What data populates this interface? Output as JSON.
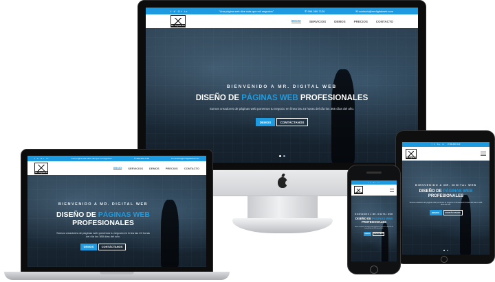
{
  "site": {
    "tagline": "\"Una página web dice más que mil negocios\"",
    "phone": "✆ 996-360-7120",
    "email": "✉ contacto@mrdigitalweb.com",
    "social": "f ✔ G+ in",
    "logo_text": "Mr. Digital Web",
    "nav": [
      {
        "label": "INICIO",
        "active": true
      },
      {
        "label": "SERVICIOS",
        "active": false
      },
      {
        "label": "DEMOS",
        "active": false
      },
      {
        "label": "PRECIOS",
        "active": false
      },
      {
        "label": "CONTACTO",
        "active": false
      }
    ],
    "hero": {
      "kicker": "BIENVENIDO A MR. DIGITAL WEB",
      "title_part1": "DISEÑO DE ",
      "title_highlight": "PÁGINAS WEB",
      "title_part2": " PROFESIONALES",
      "subtext": "Somos creadores de páginas web ponemos tu negocio en línea las 24 horas del día los 365 días del año.",
      "button_primary": "DEMOS",
      "button_secondary": "CONTÁCTANOS"
    }
  },
  "colors": {
    "accent": "#1e9be0",
    "nav_bg": "#ffffff",
    "hero_dark": "#1d2c3a"
  },
  "devices": [
    "imac",
    "macbook",
    "iphone",
    "ipad"
  ]
}
